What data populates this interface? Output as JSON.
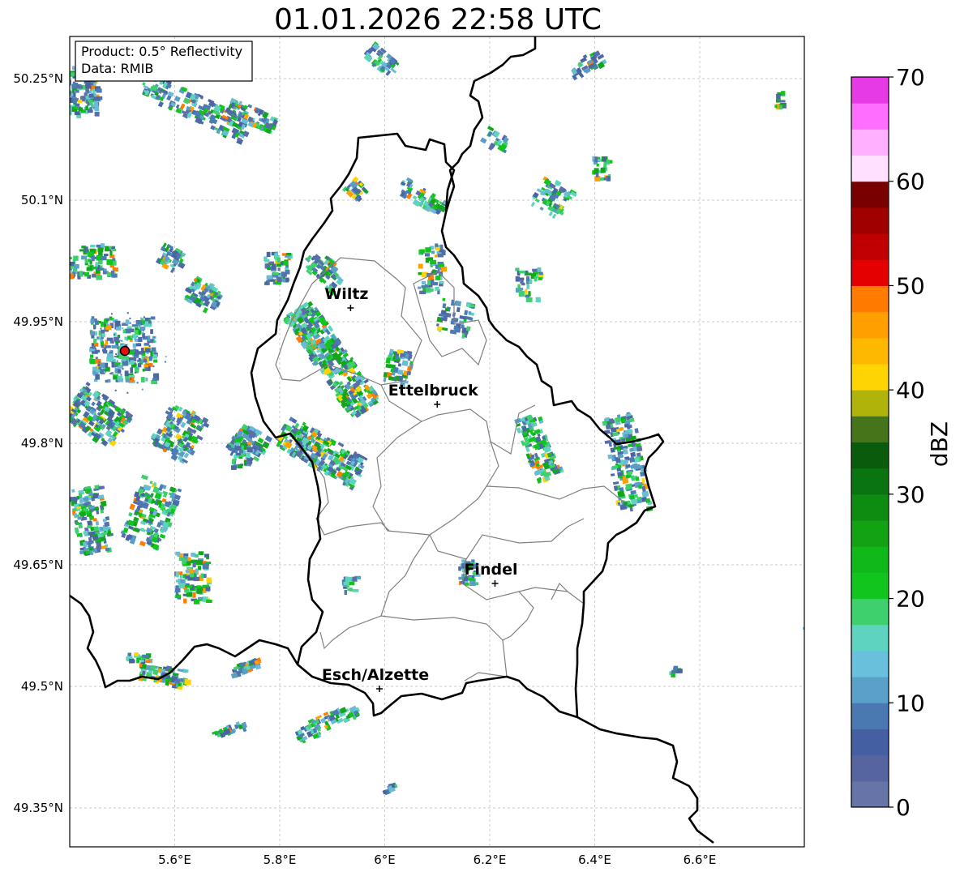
{
  "title": "01.01.2026 22:58 UTC",
  "info": {
    "product": "Product: 0.5° Reflectivity",
    "data": "Data: RMIB"
  },
  "map": {
    "lon_range": [
      5.4,
      6.8
    ],
    "lat_range": [
      49.3,
      50.3
    ],
    "lon_ticks": [
      "5.6°E",
      "5.8°E",
      "6°E",
      "6.2°E",
      "6.4°E",
      "6.6°E"
    ],
    "lat_ticks": [
      "50.25°N",
      "50.1°N",
      "49.95°N",
      "49.8°N",
      "49.65°N",
      "49.5°N",
      "49.35°N"
    ],
    "gridlines": true
  },
  "cities": [
    {
      "name": "Wiltz",
      "lon": 5.935,
      "lat": 49.967
    },
    {
      "name": "Ettelbruck",
      "lon": 6.1,
      "lat": 49.848
    },
    {
      "name": "Findel",
      "lon": 6.21,
      "lat": 49.627
    },
    {
      "name": "Esch/Alzette",
      "lon": 5.99,
      "lat": 49.497
    }
  ],
  "radar_site": {
    "lon": 5.505,
    "lat": 49.914
  },
  "colorbar": {
    "label": "dBZ",
    "ticks": [
      "0",
      "10",
      "20",
      "30",
      "40",
      "50",
      "60",
      "70"
    ],
    "min": 0,
    "max": 70,
    "colors": [
      "#6674a8",
      "#5664a0",
      "#4460a2",
      "#4a78b0",
      "#5aa0c8",
      "#68c0dc",
      "#5ed4c0",
      "#3ed06c",
      "#12c41e",
      "#10b81a",
      "#12a214",
      "#0e8c12",
      "#0a7410",
      "#0a5c0c",
      "#46741a",
      "#b0b40a",
      "#ffd400",
      "#ffb800",
      "#ffa000",
      "#ff7c00",
      "#e40000",
      "#c00000",
      "#a00000",
      "#780000",
      "#ffe0ff",
      "#ffb0ff",
      "#ff6eff",
      "#e63ae6"
    ]
  }
}
